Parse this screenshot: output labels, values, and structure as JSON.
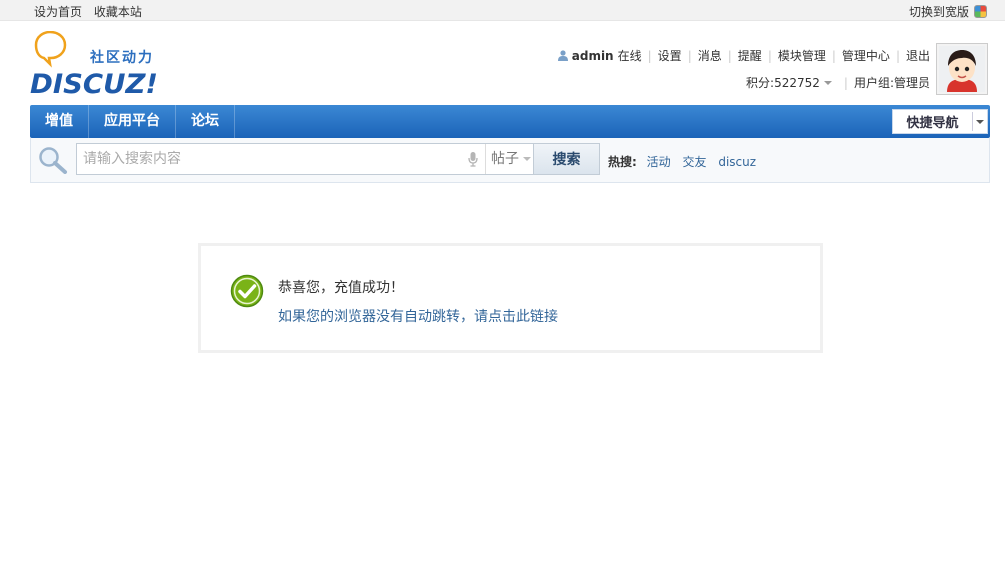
{
  "topbar": {
    "set_home": "设为首页",
    "bookmark": "收藏本站",
    "switch_wide": "切换到宽版"
  },
  "logo": {
    "slogan": "社区动力",
    "brand": "DISCUZ!"
  },
  "user": {
    "name": "admin",
    "status": "在线",
    "links": [
      "设置",
      "消息",
      "提醒",
      "模块管理",
      "管理中心",
      "退出"
    ],
    "credits_label": "积分: ",
    "credits": "522752",
    "group_label": "用户组: ",
    "group": "管理员"
  },
  "nav": {
    "items": [
      "增值",
      "应用平台",
      "论坛"
    ],
    "quick_nav": "快捷导航"
  },
  "search": {
    "placeholder": "请输入搜索内容",
    "type": "帖子",
    "button": "搜索",
    "hot_label": "热搜:",
    "hot_terms": [
      "活动",
      "交友",
      "discuz"
    ]
  },
  "message": {
    "title": "恭喜您，充值成功！",
    "link": "如果您的浏览器没有自动跳转，请点击此链接"
  },
  "colors": {
    "nav_blue": "#1b63b8",
    "link_blue": "#336699",
    "success_green": "#7ab317"
  }
}
